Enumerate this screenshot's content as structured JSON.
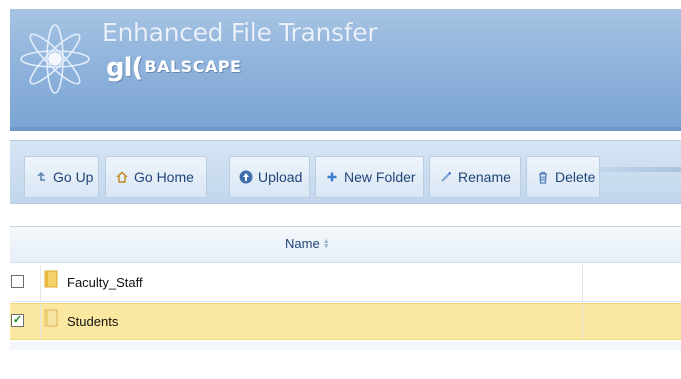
{
  "header": {
    "app_title": "Enhanced File Transfer",
    "brand_prefix": "gl(",
    "brand_suffix": "balscape",
    "colors": {
      "banner_top": "#a7c4e3",
      "banner_bottom": "#7ba4d3"
    }
  },
  "toolbar": {
    "buttons": [
      {
        "label": "Go Up",
        "icon": "arrow-up-back-icon"
      },
      {
        "label": "Go Home",
        "icon": "home-icon"
      },
      {
        "label": "Upload",
        "icon": "upload-icon"
      },
      {
        "label": "New Folder",
        "icon": "plus-icon"
      },
      {
        "label": "Rename",
        "icon": "pencil-icon"
      },
      {
        "label": "Delete",
        "icon": "trash-icon"
      }
    ]
  },
  "grid": {
    "columns": [
      {
        "label": "Name",
        "sorted": "asc"
      }
    ],
    "rows": [
      {
        "name": "Faculty_Staff",
        "checked": false,
        "selected": false
      },
      {
        "name": "Students",
        "checked": true,
        "selected": true
      }
    ],
    "colors": {
      "selected_row": "#fbe8a0",
      "check_mark": "#1b8a1b"
    }
  }
}
